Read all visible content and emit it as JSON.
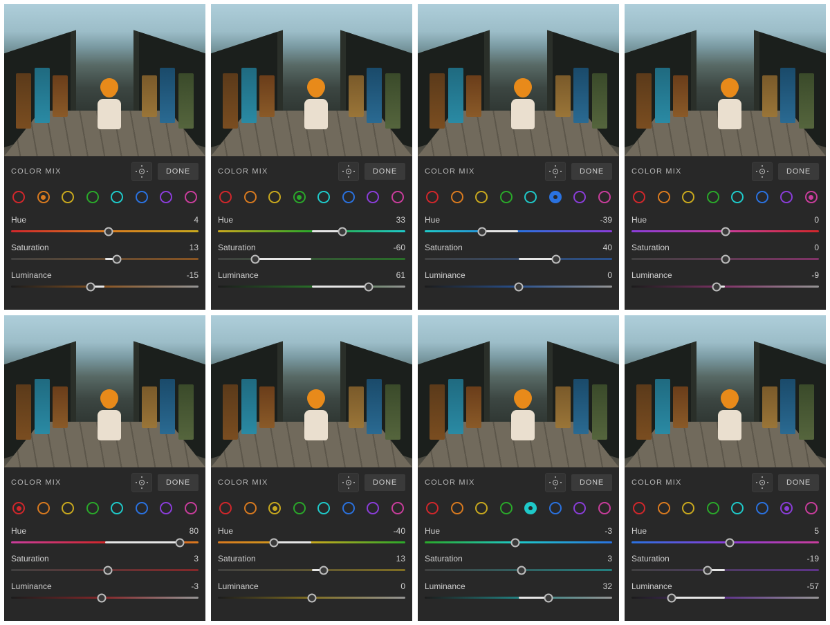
{
  "ui": {
    "title": "COLOR MIX",
    "done_label": "DONE",
    "slider_labels": {
      "hue": "Hue",
      "saturation": "Saturation",
      "luminance": "Luminance"
    }
  },
  "colors": [
    {
      "key": "red",
      "hex": "#d1272b"
    },
    {
      "key": "orange",
      "hex": "#d97a1f"
    },
    {
      "key": "yellow",
      "hex": "#c9a91e"
    },
    {
      "key": "green",
      "hex": "#2aa82a"
    },
    {
      "key": "aqua",
      "hex": "#1fc9c9"
    },
    {
      "key": "blue",
      "hex": "#2a72e0"
    },
    {
      "key": "purple",
      "hex": "#8a3dd9"
    },
    {
      "key": "magenta",
      "hex": "#c93d9c"
    }
  ],
  "hue_gradients": {
    "red": [
      "#c93d9c",
      "#d1272b",
      "#d97a1f"
    ],
    "orange": [
      "#d1272b",
      "#d97a1f",
      "#c9a91e"
    ],
    "yellow": [
      "#d97a1f",
      "#c9a91e",
      "#2aa82a"
    ],
    "green": [
      "#c9a91e",
      "#2aa82a",
      "#1fc9c9"
    ],
    "aqua": [
      "#2aa82a",
      "#1fc9c9",
      "#2a72e0"
    ],
    "blue": [
      "#1fc9c9",
      "#2a72e0",
      "#8a3dd9"
    ],
    "purple": [
      "#2a72e0",
      "#8a3dd9",
      "#c93d9c"
    ],
    "magenta": [
      "#8a3dd9",
      "#c93d9c",
      "#d1272b"
    ]
  },
  "panels": [
    {
      "selected": "orange",
      "hue": 4,
      "saturation": 13,
      "luminance": -15
    },
    {
      "selected": "green",
      "hue": 33,
      "saturation": -60,
      "luminance": 61
    },
    {
      "selected": "blue",
      "hue": -39,
      "saturation": 40,
      "luminance": 0
    },
    {
      "selected": "magenta",
      "hue": 0,
      "saturation": 0,
      "luminance": -9
    },
    {
      "selected": "red",
      "hue": 80,
      "saturation": 3,
      "luminance": -3
    },
    {
      "selected": "yellow",
      "hue": -40,
      "saturation": 13,
      "luminance": 0
    },
    {
      "selected": "aqua",
      "hue": -3,
      "saturation": 3,
      "luminance": 32
    },
    {
      "selected": "purple",
      "hue": 5,
      "saturation": -19,
      "luminance": -57
    }
  ]
}
